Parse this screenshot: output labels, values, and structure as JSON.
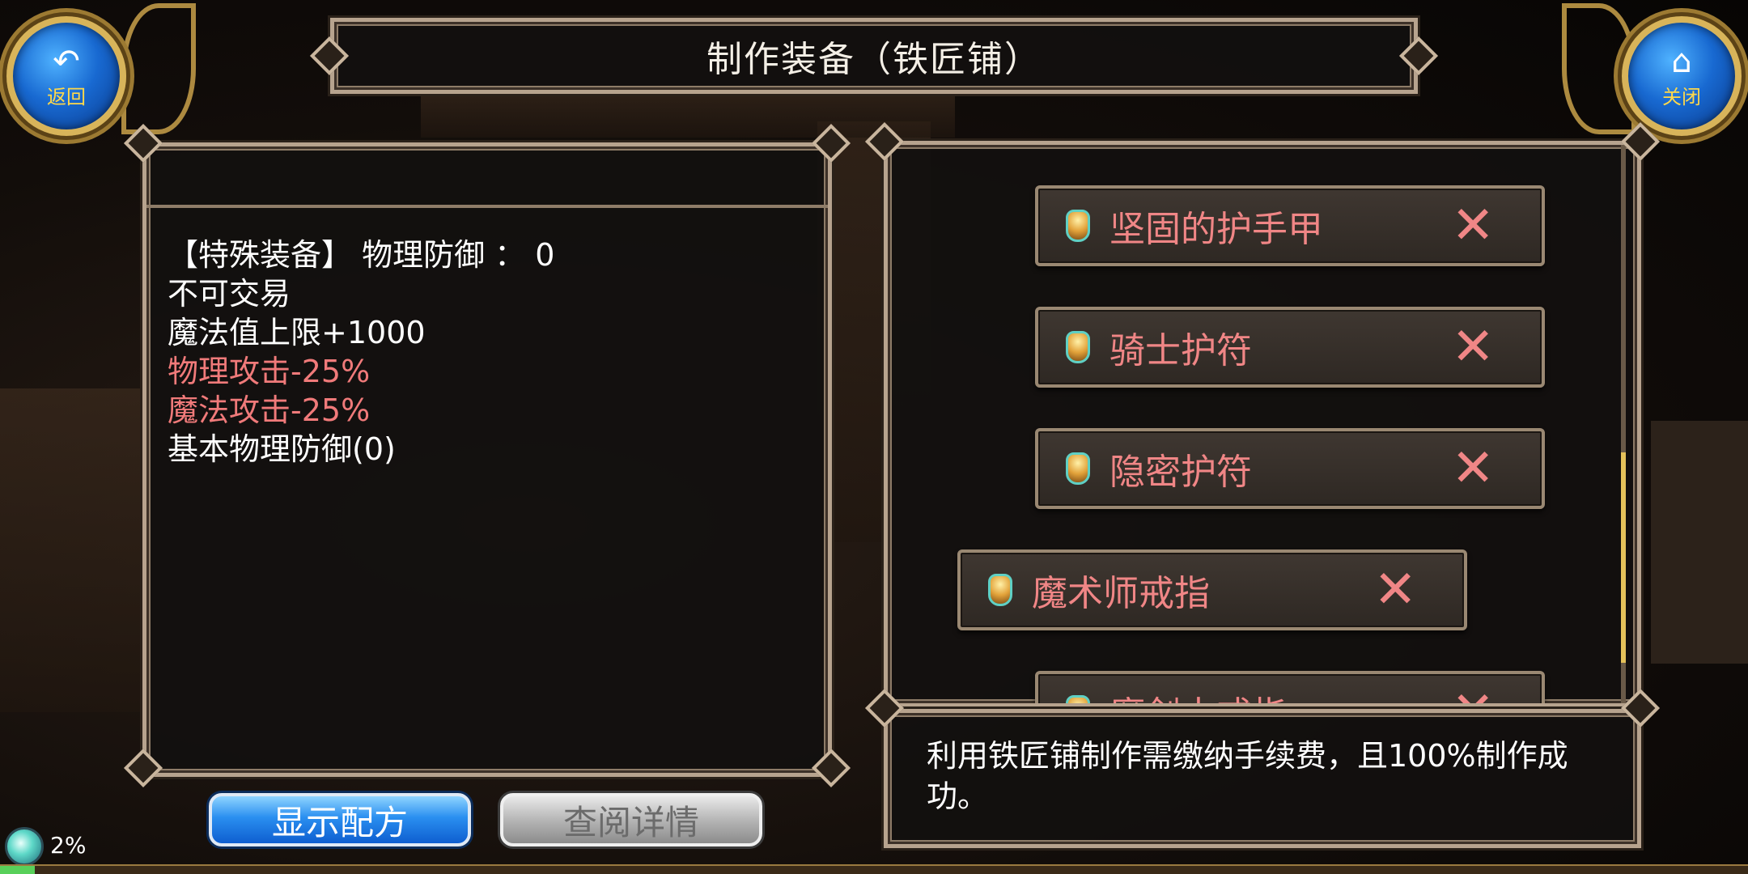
{
  "title": "制作装备（铁匠铺）",
  "buttons": {
    "back": {
      "label": "返回",
      "icon": "return-arrow-icon"
    },
    "close": {
      "label": "关闭",
      "icon": "home-icon"
    },
    "show_recipe": "显示配方",
    "view_details": "查阅详情"
  },
  "item_desc": {
    "lines": [
      {
        "text": "【特殊装备】 物理防御 ：  0",
        "color": "#ffffff"
      },
      {
        "text": "不可交易",
        "color": "#ffffff"
      },
      {
        "text": "魔法值上限+1000",
        "color": "#ffffff"
      },
      {
        "text": "物理攻击-25%",
        "color": "#f07a7a"
      },
      {
        "text": "魔法攻击-25%",
        "color": "#f07a7a"
      },
      {
        "text": "基本物理防御(0)",
        "color": "#ffffff"
      }
    ]
  },
  "recipe_list": [
    {
      "name": "坚固的护手甲"
    },
    {
      "name": "骑士护符"
    },
    {
      "name": "隐密护符"
    },
    {
      "name": "魔术师戒指"
    },
    {
      "name": "魔剑士戒指"
    }
  ],
  "info": "利用铁匠铺制作需缴纳手续费，且100%制作成功。",
  "status": {
    "percent": "2%",
    "exp_fraction": 0.02
  },
  "colors": {
    "accent_red": "#f08686",
    "gold": "#d8b45a",
    "blue": "#1869d1"
  }
}
